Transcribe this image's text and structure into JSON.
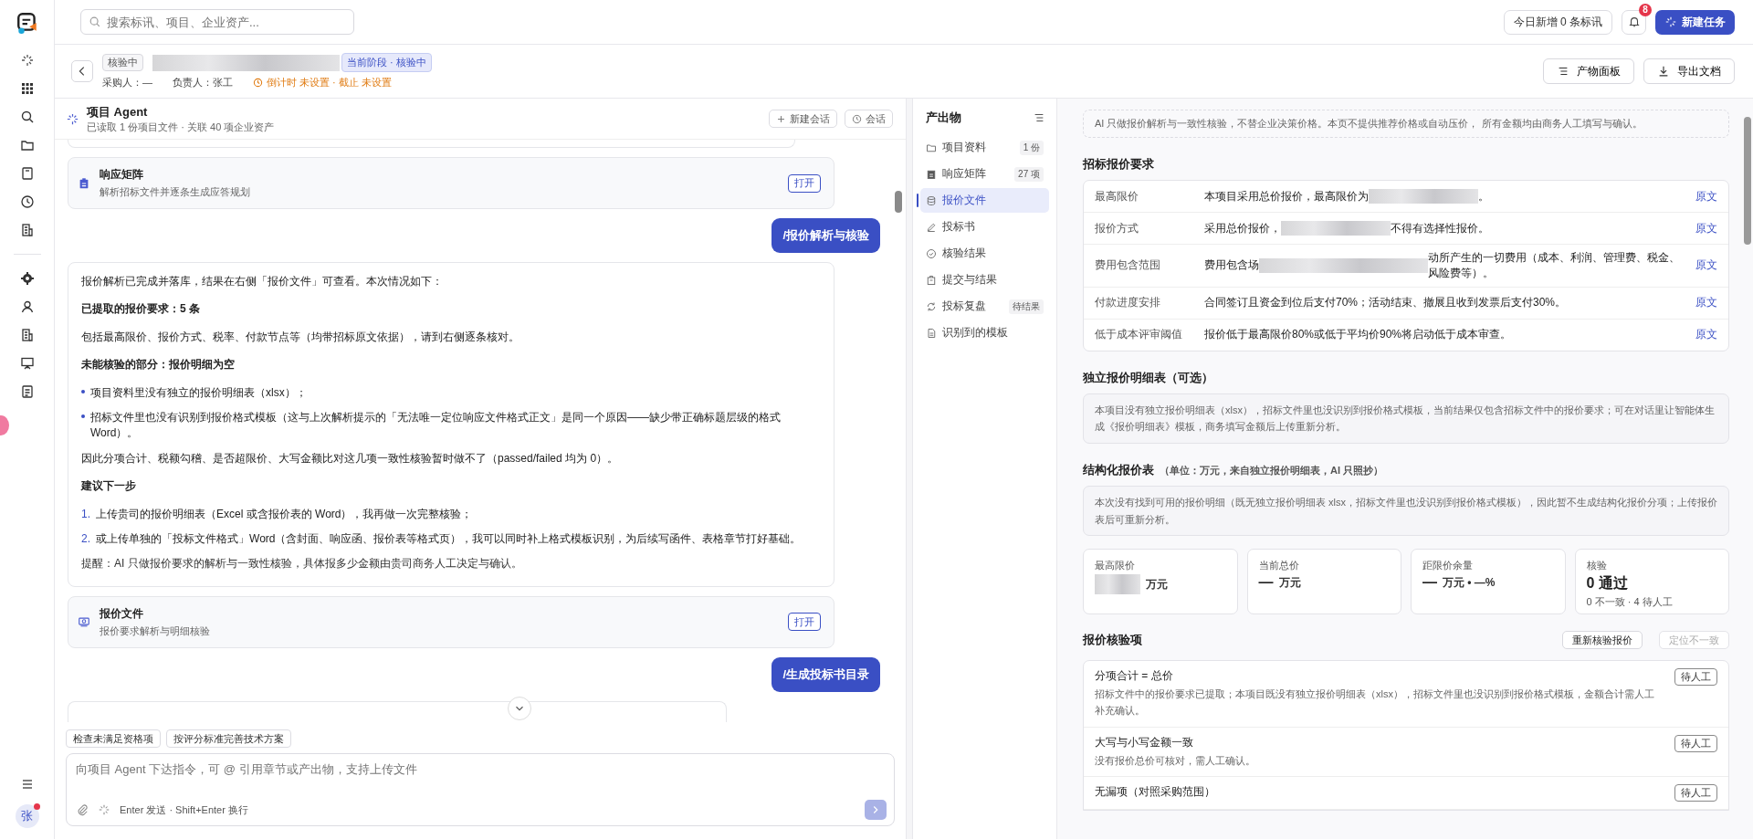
{
  "topbar": {
    "search_placeholder": "搜索标讯、项目、企业资产...",
    "today_new": "今日新增 0 条标讯",
    "notification_count": "8",
    "new_task": "新建任务"
  },
  "rail": {
    "avatar": "张",
    "avatar_alert": true
  },
  "project": {
    "status": "核验中",
    "title_redacted": true,
    "stage": "当前阶段 · 核验中",
    "buyer": "采购人：—",
    "owner": "负责人：张工",
    "deadline": "倒计时 未设置 · 截止 未设置",
    "actions": [
      "产物面板",
      "导出文档"
    ]
  },
  "agent": {
    "title": "项目 Agent",
    "subtitle": "已读取 1 份项目文件 · 关联 40 项企业资产",
    "new_chat": "新建会话",
    "history": "会话"
  },
  "messages": [
    {
      "kind": "partial"
    },
    {
      "kind": "card",
      "title": "响应矩阵",
      "desc": "解析招标文件并逐条生成应答规划",
      "action": "打开"
    },
    {
      "kind": "user",
      "text": "/报价解析与核验"
    },
    {
      "kind": "assistant",
      "blocks": [
        {
          "kind": "para",
          "text": "报价解析已完成并落库，结果在右侧「报价文件」可查看。本次情况如下："
        },
        {
          "kind": "heading",
          "text": "已提取的报价要求：5 条"
        },
        {
          "kind": "para",
          "text": "包括最高限价、报价方式、税率、付款节点等（均带招标原文依据），请到右侧逐条核对。"
        },
        {
          "kind": "heading",
          "text": "未能核验的部分：报价明细为空"
        },
        {
          "kind": "bullet",
          "text": "项目资料里没有独立的报价明细表（xlsx）；"
        },
        {
          "kind": "bullet",
          "text": "招标文件里也没有识别到报价格式模板（这与上次解析提示的「无法唯一定位响应文件格式正文」是同一个原因——缺少带正确标题层级的格式 Word）。"
        },
        {
          "kind": "para",
          "text": "因此分项合计、税额勾稽、是否超限价、大写金额比对这几项一致性核验暂时做不了（passed/failed 均为 0）。"
        },
        {
          "kind": "heading",
          "text": "建议下一步"
        },
        {
          "kind": "numbered",
          "marker": "1.",
          "text": "上传贵司的报价明细表（Excel 或含报价表的 Word），我再做一次完整核验；"
        },
        {
          "kind": "numbered",
          "marker": "2.",
          "text": "或上传单独的「投标文件格式」Word（含封面、响应函、报价表等格式页），我可以同时补上格式模板识别，为后续写函件、表格章节打好基础。"
        },
        {
          "kind": "note",
          "text": "提醒：AI 只做报价要求的解析与一致性核验，具体报多少金额由贵司商务人工决定与确认。"
        }
      ]
    },
    {
      "kind": "card",
      "title": "报价文件",
      "desc": "报价要求解析与明细核验",
      "action": "打开"
    },
    {
      "kind": "user",
      "text": "/生成投标书目录"
    },
    {
      "kind": "partial_bottom"
    }
  ],
  "suggestions": [
    "检查未满足资格项",
    "按评分标准完善技术方案"
  ],
  "composer": {
    "placeholder": "向项目 Agent 下达指令，可 @ 引用章节或产出物，支持上传文件",
    "hint": "Enter 发送 · Shift+Enter 换行"
  },
  "outputs": {
    "title": "产出物",
    "items": [
      {
        "label": "项目资料",
        "count": "1 份",
        "selected": false
      },
      {
        "label": "响应矩阵",
        "count": "27 项",
        "selected": false
      },
      {
        "label": "报价文件",
        "selected": true
      },
      {
        "label": "投标书",
        "selected": false
      },
      {
        "label": "核验结果",
        "selected": false
      },
      {
        "label": "提交与结果",
        "selected": false
      },
      {
        "label": "投标复盘",
        "count": "待结果",
        "selected": false
      },
      {
        "label": "识别到的模板",
        "selected": false
      }
    ]
  },
  "notice": "AI 只做报价解析与一致性核验，不替企业决策价格。本页不提供推荐价格或自动压价， 所有金额均由商务人工填写与确认。",
  "requirements": {
    "title": "招标报价要求",
    "rows": [
      {
        "label": "最高限价",
        "segments": [
          {
            "kind": "text",
            "text": "本项目采用总价报价，最高限价为"
          },
          {
            "kind": "redacted"
          },
          {
            "kind": "text",
            "text": "。"
          }
        ],
        "link": "原文"
      },
      {
        "label": "报价方式",
        "segments": [
          {
            "kind": "text",
            "text": "采用总价报价，"
          },
          {
            "kind": "redacted"
          },
          {
            "kind": "text",
            "text": "不得有选择性报价。"
          }
        ],
        "link": "原文"
      },
      {
        "label": "费用包含范围",
        "segments": [
          {
            "kind": "text",
            "text": "费用包含场"
          },
          {
            "kind": "redacted"
          },
          {
            "kind": "text",
            "text": "动所产生的一切费用（成本、利润、管理费、税金、风险费等）。"
          }
        ],
        "link": "原文"
      },
      {
        "label": "付款进度安排",
        "segments": [
          {
            "kind": "text",
            "text": "合同签订且资金到位后支付70%；活动结束、撤展且收到发票后支付30%。"
          }
        ],
        "link": "原文"
      },
      {
        "label": "低于成本评审阈值",
        "segments": [
          {
            "kind": "text",
            "text": "报价低于最高限价80%或低于平均价90%将启动低于成本审查。"
          }
        ],
        "link": "原文"
      }
    ]
  },
  "detail_table": {
    "title": "独立报价明细表（可选）",
    "text": "本项目没有独立报价明细表（xlsx），招标文件里也没识别到报价格式模板，当前结果仅包含招标文件中的报价要求；可在对话里让智能体生成《报价明细表》模板，商务填写金额后上传重新分析。"
  },
  "structured": {
    "title": "结构化报价表",
    "note": "（单位：万元，来自独立报价明细表，AI 只照抄）",
    "text": "本次没有找到可用的报价明细（既无独立报价明细表 xlsx，招标文件里也没识别到报价格式模板），因此暂不生成结构化报价分项；上传报价表后可重新分析。"
  },
  "stats": [
    {
      "kind": "amount",
      "label": "最高限价",
      "redacted": true,
      "unit": "万元"
    },
    {
      "kind": "amount",
      "label": "当前总价",
      "value": "—",
      "unit": "万元"
    },
    {
      "kind": "amount",
      "label": "距限价余量",
      "value": "—",
      "unit": "万元 • —%"
    },
    {
      "kind": "check",
      "label": "核验",
      "value": "0 通过",
      "sub": "0 不一致 · 4 待人工"
    }
  ],
  "checks": {
    "title": "报价核验项",
    "buttons": [
      {
        "label": "重新核验报价",
        "disabled": false
      },
      {
        "label": "定位不一致",
        "disabled": true
      }
    ],
    "items": [
      {
        "title": "分项合计 = 总价",
        "desc": "招标文件中的报价要求已提取；本项目既没有独立报价明细表（xlsx），招标文件里也没识别到报价格式模板，金额合计需人工补充确认。",
        "status": "待人工"
      },
      {
        "title": "大写与小写金额一致",
        "desc": "没有报价总价可核对，需人工确认。",
        "status": "待人工"
      },
      {
        "title": "无漏项（对照采购范围）",
        "status": "待人工"
      }
    ]
  }
}
